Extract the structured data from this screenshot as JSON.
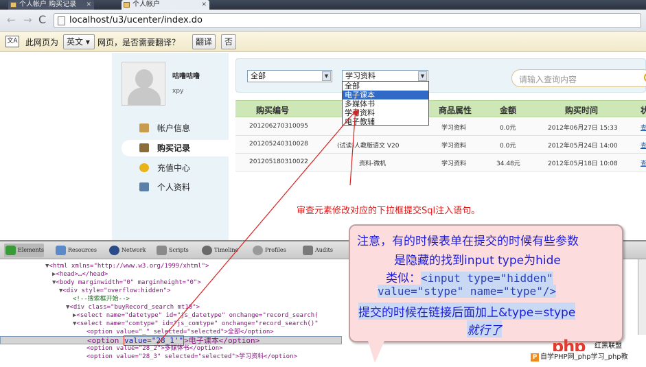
{
  "browser": {
    "tabs": [
      {
        "title": "个人帐户 购买记录"
      },
      {
        "title": "个人帐户"
      }
    ],
    "address": "localhost/u3/ucenter/index.do",
    "translate_bar": {
      "prefix": "此网页为",
      "language": "英文",
      "question": "网页，是否需要翻译？",
      "translate_button": "翻译",
      "no_button": "否"
    }
  },
  "sidebar": {
    "user_name": "咕噜咕噜",
    "user_login": "xpy",
    "menu": [
      {
        "label": "帐户信息",
        "icon": "folder-icon",
        "color": "#c89b4e"
      },
      {
        "label": "购买记录",
        "icon": "file-icon",
        "color": "#8a6d3b"
      },
      {
        "label": "充值中心",
        "icon": "coin-icon",
        "color": "#e8b418"
      },
      {
        "label": "个人资料",
        "icon": "id-card-icon",
        "color": "#5a7fa8"
      }
    ]
  },
  "search": {
    "date_select": "全部",
    "type_select": "学习资料",
    "type_options": [
      "全部",
      "电子课本",
      "多媒体书",
      "学习资料",
      "电子教辅"
    ],
    "highlighted_option": "电子课本",
    "placeholder": "请输入查询内容"
  },
  "table": {
    "headers": [
      "购买编号",
      "",
      "商品属性",
      "金额",
      "购买时间",
      "状"
    ],
    "rows": [
      {
        "id": "201206270310095",
        "name": "",
        "attr": "学习资料",
        "amount": "0.0元",
        "time": "2012年06月27日 15:33",
        "action": "查"
      },
      {
        "id": "201205240310028",
        "name": "(试读)人教版语文 V20",
        "attr": "学习资料",
        "amount": "0.0元",
        "time": "2012年05月24日 14:00",
        "action": "查"
      },
      {
        "id": "201205180310022",
        "name": "资料-微机",
        "attr": "学习资料",
        "amount": "34.48元",
        "time": "2012年05月18日 10:08",
        "action": "查"
      }
    ]
  },
  "annotation_red": "审查元素修改对应的下拉框提交Sql注入语句。",
  "devtools": {
    "tabs": [
      "Elements",
      "Resources",
      "Network",
      "Scripts",
      "Timeline",
      "Profiles",
      "Audits"
    ],
    "lines": {
      "l1": "<html xmlns=\"http://www.w3.org/1999/xhtml\">",
      "l2": "<head>…</head>",
      "l3": "<body marginwidth=\"0\" marginheight=\"0\">",
      "l4": "<div style=\"overflow:hidden\">",
      "l5": "<!--搜索框开始-->",
      "l6": "<div class=\"buyRecord_search mt10\">",
      "l7": "<select name=\"datetype\" id=\"js_datetype\" onchange=\"record_search(",
      "l8": "<select name=\"comtype\" id=\"js_comtype\" onchange=\"record_search()\"",
      "l9": "<option value=\"_\" selected=\"selected\">全部</option>",
      "l10a": "<option ",
      "l10b": "value=\"28_1'\"",
      "l10c": ">电子课本</option>",
      "l11": "<option value=\"28_2\">多媒体书</option>",
      "l12": "<option value=\"28_3\" selected=\"selected\">学习资料</option>"
    }
  },
  "note": {
    "line1": "注意，有的时候表单在提交的时候有些参数",
    "line2": "是隐藏的找到input type为hide",
    "line3_prefix": "类似：",
    "code1": "<input type=\"hidden\"",
    "code2": "value=\"stype\" name=\"type\"/>",
    "line5": "提交的时候在链接后面加上&type=stype",
    "line6": "就行了"
  },
  "watermark": {
    "logo": "php",
    "tag": "红黑联盟",
    "bar": "自学PHP网_php学习_php教"
  }
}
